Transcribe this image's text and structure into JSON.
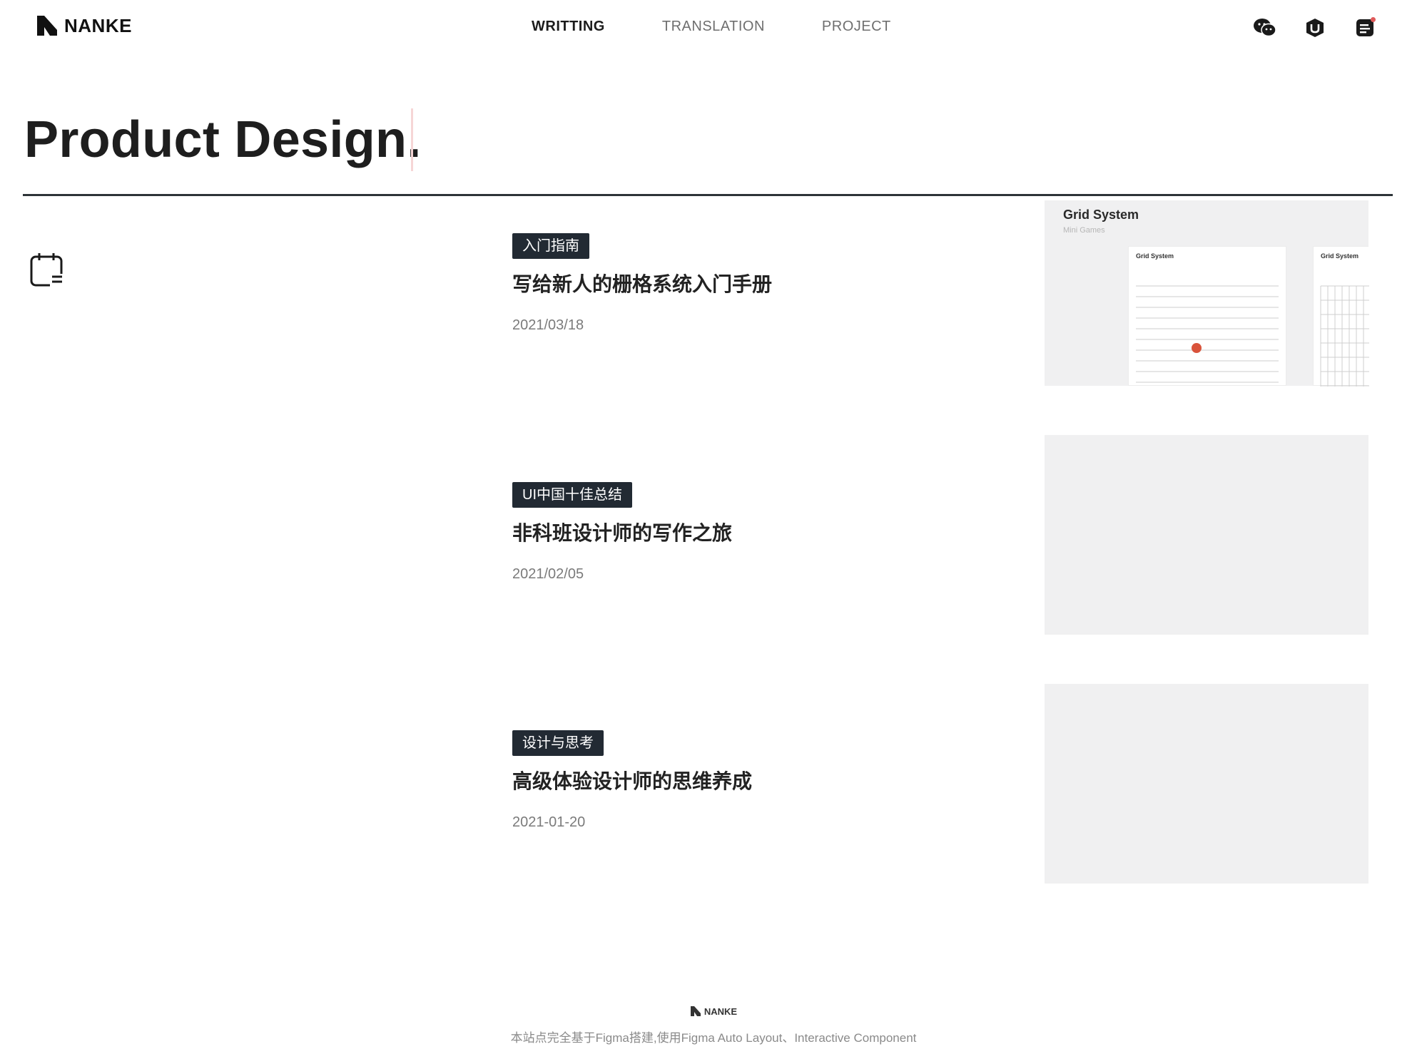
{
  "header": {
    "brand": "NANKE",
    "nav": [
      {
        "label": "WRITTING",
        "active": true
      },
      {
        "label": "TRANSLATION",
        "active": false
      },
      {
        "label": "PROJECT",
        "active": false
      }
    ],
    "icons": [
      "wechat-icon",
      "user-badge-icon",
      "notes-icon"
    ]
  },
  "hero": {
    "title": "Product Design."
  },
  "articles": [
    {
      "tag": "入门指南",
      "title": "写给新人的栅格系统入门手册",
      "date": "2021/03/18",
      "thumbnail": {
        "title": "Grid System",
        "subtitle": "Mini Games",
        "sheet_a_title": "Grid System",
        "sheet_b_title": "Grid System"
      }
    },
    {
      "tag": "UI中国十佳总结",
      "title": "非科班设计师的写作之旅",
      "date": "2021/02/05"
    },
    {
      "tag": "设计与思考",
      "title": "高级体验设计师的思维养成",
      "date": "2021-01-20"
    }
  ],
  "footer": {
    "brand": "NANKE",
    "note": "本站点完全基于Figma搭建,使用Figma Auto Layout、Interactive Component"
  },
  "colors": {
    "tag_bg": "#222a33",
    "accent_dot": "#d9533b",
    "rule": "#2d3438"
  }
}
